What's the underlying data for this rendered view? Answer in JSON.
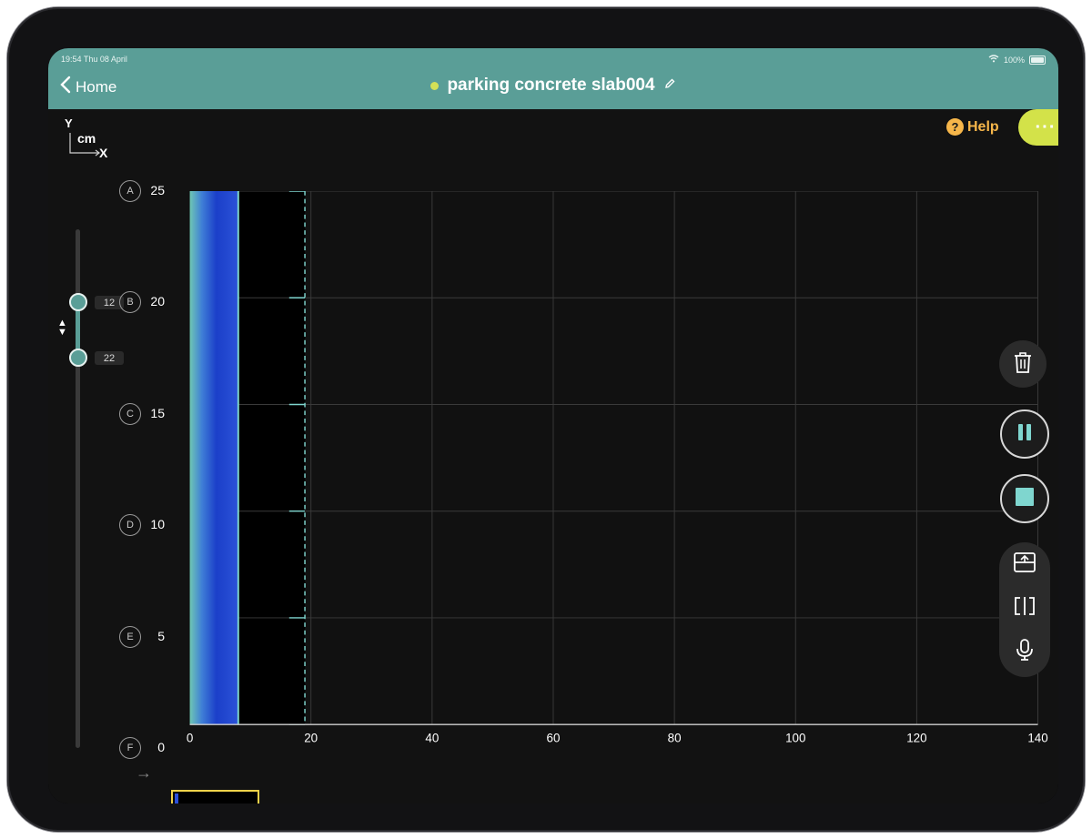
{
  "status": {
    "time": "19:54 Thu 08 April",
    "battery": "100%"
  },
  "nav": {
    "back_label": "Home",
    "title": "parking concrete slab004"
  },
  "toolbar": {
    "help_label": "Help",
    "help_badge": "?",
    "more_label": "···"
  },
  "axes": {
    "y_title": "Y",
    "unit": "cm",
    "x_title": "X"
  },
  "chart_data": {
    "type": "heatmap",
    "xlim": [
      0,
      140
    ],
    "ylim": [
      0,
      25
    ],
    "x_ticks": [
      0,
      20,
      40,
      60,
      80,
      100,
      120,
      140
    ],
    "y_ticks": [
      25,
      20,
      15,
      10,
      5,
      0
    ],
    "row_labels": [
      "A",
      "B",
      "C",
      "D",
      "E",
      "F"
    ],
    "scanned_x_range": [
      0,
      8
    ],
    "cursor_x": 8,
    "scan_limit_x": 19,
    "grid": true
  },
  "depth_slider": {
    "upper_value": "12",
    "lower_value": "22",
    "upper_fraction": 0.13,
    "lower_fraction": 0.23
  },
  "colors": {
    "nav": "#5a9e97",
    "accent": "#7fd6cf",
    "more": "#d3e249",
    "help": "#f6b64a",
    "scan_deep": "#1b3fc9",
    "scan_light": "#6fc6b4"
  },
  "side_tools": {
    "delete": "trash-icon",
    "pause": "pause-icon",
    "stop": "stop-icon",
    "split": "layout-icon",
    "compare": "split-icon",
    "mic": "mic-icon"
  }
}
